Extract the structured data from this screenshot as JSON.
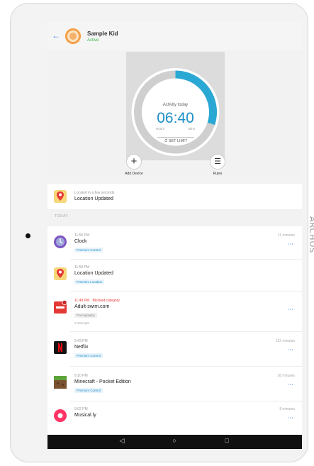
{
  "device": {
    "brand": "ARCHOS"
  },
  "header": {
    "name": "Sample Kid",
    "status": "Active"
  },
  "dial": {
    "label": "Activity today",
    "time": "06:40",
    "hours_label": "Hours",
    "mins_label": "Mins",
    "set_limit_label": "SET LIMIT",
    "progress_fraction": 0.3
  },
  "actions": {
    "add_device": "Add Device",
    "rules": "Rules"
  },
  "location_card": {
    "time": "Located in a few seconds",
    "title": "Location Updated"
  },
  "section_label": "TODAY",
  "activity": [
    {
      "time": "11:56 PM",
      "title": "Clock",
      "tag": "Premium Control",
      "duration": "11 minutes"
    },
    {
      "time": "11:59 PM",
      "title": "Location Updated",
      "tag": "Premium Location",
      "duration": ""
    },
    {
      "time": "11:49 PM · Blocked category",
      "title": "Adult-swim.com",
      "tag": "Pornography",
      "sub": "2 attempts",
      "duration": ""
    },
    {
      "time": "9:43 PM",
      "title": "Netflix",
      "tag": "Premium Control",
      "duration": "122 minutes"
    },
    {
      "time": "9:10 PM",
      "title": "Minecraft - Pocket Edition",
      "tag": "Premium Control",
      "duration": "28 minutes"
    },
    {
      "time": "9:02 PM",
      "title": "Musical.ly",
      "tag": "",
      "duration": "8 minutes"
    }
  ],
  "colors": {
    "accent": "#1c8fc7",
    "active": "#3bb54a",
    "blocked": "#e53935"
  }
}
